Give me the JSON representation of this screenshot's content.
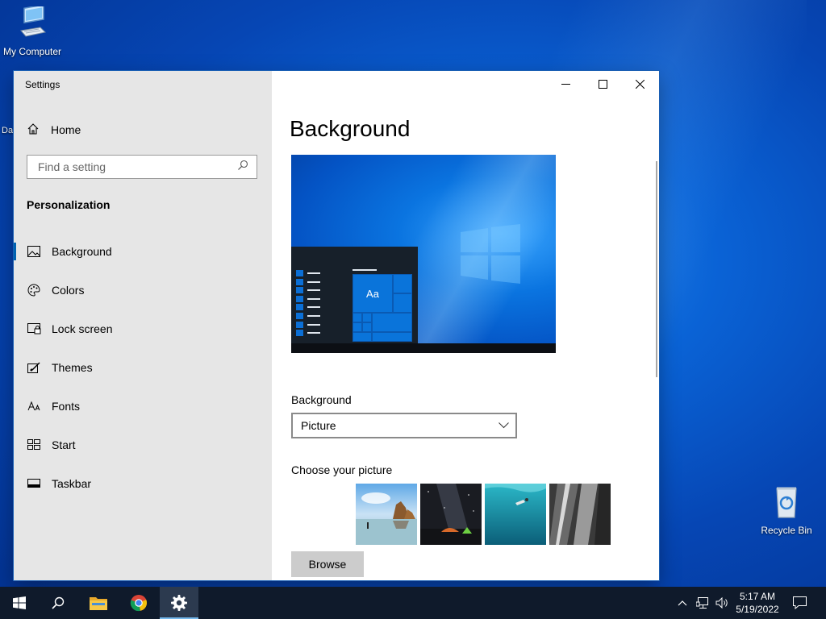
{
  "desktop": {
    "icons": [
      {
        "label": "My Computer"
      },
      {
        "label": "Recycle Bin"
      }
    ],
    "partial_label": "Da"
  },
  "window": {
    "title": "Settings",
    "home_label": "Home",
    "search": {
      "placeholder": "Find a setting"
    },
    "section_title": "Personalization",
    "nav_items": [
      {
        "label": "Background",
        "icon": "picture-icon",
        "active": true
      },
      {
        "label": "Colors",
        "icon": "palette-icon"
      },
      {
        "label": "Lock screen",
        "icon": "lock-screen-icon"
      },
      {
        "label": "Themes",
        "icon": "brush-icon"
      },
      {
        "label": "Fonts",
        "icon": "font-icon"
      },
      {
        "label": "Start",
        "icon": "start-icon"
      },
      {
        "label": "Taskbar",
        "icon": "taskbar-icon"
      }
    ],
    "controls": {
      "minimize": "minimize-icon",
      "maximize": "maximize-icon",
      "close": "close-icon"
    }
  },
  "content": {
    "page_title": "Background",
    "preview": {
      "sample_text": "Aa"
    },
    "background_label": "Background",
    "background_select": {
      "value": "Picture"
    },
    "choose_label": "Choose your picture",
    "thumbnails": [
      "beach-rocks-thumbnail",
      "night-sky-tent-thumbnail",
      "underwater-diver-thumbnail",
      "rock-cliff-thumbnail"
    ],
    "browse_label": "Browse"
  },
  "taskbar": {
    "apps": [
      "start-icon",
      "search-icon",
      "file-explorer-icon",
      "chrome-icon",
      "settings-icon"
    ],
    "active_app": "settings-icon",
    "tray": [
      "chevron-up-icon",
      "network-icon",
      "volume-icon"
    ],
    "clock": {
      "time": "5:17 AM",
      "date": "5/19/2022"
    },
    "notification_icon": "action-center-icon"
  },
  "colors": {
    "accent": "#0063b1",
    "sidebar": "#e6e6e6",
    "taskbar": "#0f1a2b",
    "desktop": "#0a63d6"
  }
}
